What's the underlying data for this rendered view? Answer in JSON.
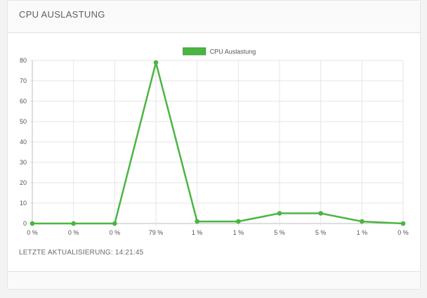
{
  "card": {
    "title": "CPU AUSLASTUNG",
    "update_label": "LETZTE AKTUALISIERUNG: 14:21:45"
  },
  "colors": {
    "series": "#4bb543",
    "grid": "#e6e6e6",
    "axis": "#bdbdbd"
  },
  "chart_data": {
    "type": "line",
    "title": "",
    "xlabel": "",
    "ylabel": "",
    "categories": [
      "0 %",
      "0 %",
      "0 %",
      "79 %",
      "1 %",
      "1 %",
      "5 %",
      "5 %",
      "1 %",
      "0 %"
    ],
    "series": [
      {
        "name": "CPU Auslastung",
        "values": [
          0,
          0,
          0,
          79,
          1,
          1,
          5,
          5,
          1,
          0
        ]
      }
    ],
    "ylim": [
      0,
      80
    ],
    "yticks": [
      0,
      10,
      20,
      30,
      40,
      50,
      60,
      70,
      80
    ],
    "grid": true,
    "legend": "top-center"
  }
}
